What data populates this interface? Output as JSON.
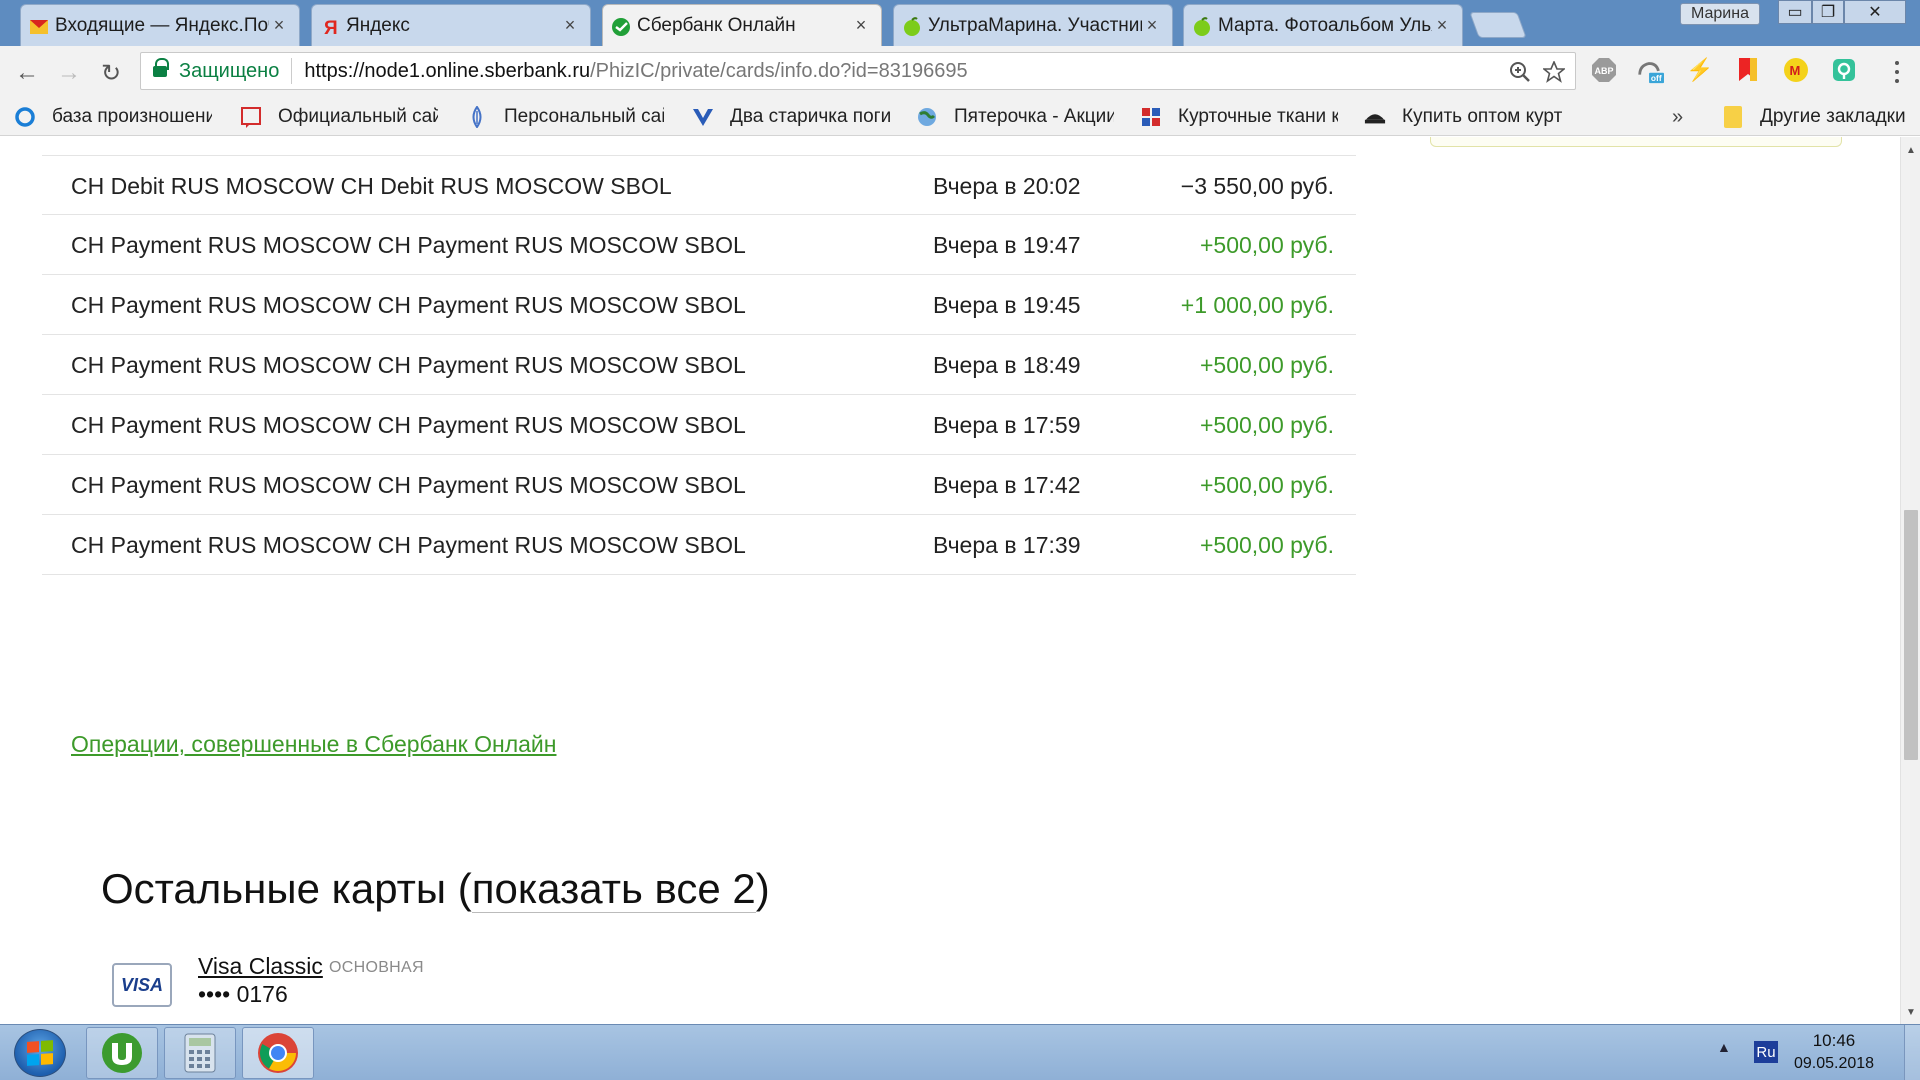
{
  "colors": {
    "positive": "#3d9a2a",
    "negative": "#222222",
    "link_green": "#3d9a2a",
    "secure_green": "#0b8043"
  },
  "browser": {
    "tabs": [
      {
        "title": "Входящие — Яндекс.Почта",
        "icon": "mail-icon",
        "close": "×"
      },
      {
        "title": "Яндекс",
        "icon": "yandex-icon",
        "close": "×"
      },
      {
        "title": "Сбербанк Онлайн",
        "icon": "sberbank-icon",
        "close": "×",
        "active": true
      },
      {
        "title": "УльтраМарина. Участники",
        "icon": "apple-icon",
        "close": "×"
      },
      {
        "title": "Марта. Фотоальбом Ульяна",
        "icon": "apple-icon",
        "close": "×"
      }
    ],
    "profile_name": "Марина",
    "window_controls": {
      "minimize": "▭",
      "restore": "❐",
      "close": "✕"
    },
    "nav": {
      "back": "←",
      "forward": "→",
      "reload": "↻"
    },
    "address": {
      "secure_label": "Защищено",
      "url_host": "https://node1.online.sberbank.ru",
      "url_path": "/PhizIC/private/cards/info.do?id=83196695"
    },
    "extensions": [
      {
        "name": "adblock-icon",
        "label": "ABP"
      },
      {
        "name": "vpn-off-icon",
        "label": "off"
      },
      {
        "name": "lightning-icon",
        "label": "⚡"
      },
      {
        "name": "bookmark-flag-icon",
        "label": ""
      },
      {
        "name": "metro-icon",
        "label": "M"
      },
      {
        "name": "screenshot-icon",
        "label": ""
      }
    ],
    "bookmarks": [
      {
        "label": "база произношений",
        "icon": "circle-icon"
      },
      {
        "label": "Официальный сайт",
        "icon": "frame-icon"
      },
      {
        "label": "Персональный сайт",
        "icon": "drop-icon"
      },
      {
        "label": "Два старичка погибли",
        "icon": "news-icon"
      },
      {
        "label": "Пятерочка - Акции",
        "icon": "globe-icon"
      },
      {
        "label": "Курточные ткани купить",
        "icon": "fabric-icon"
      },
      {
        "label": "Купить оптом куртки",
        "icon": "hat-icon"
      }
    ],
    "bookmarks_more": "»",
    "other_bookmarks": "Другие закладки"
  },
  "transactions": [
    {
      "description": "CH Debit RUS MOSCOW CH Debit RUS MOSCOW SBOL",
      "date": "Вчера в 20:02",
      "amount": "−3 550,00 руб.",
      "sign": "negative"
    },
    {
      "description": "CH Payment RUS MOSCOW CH Payment RUS MOSCOW SBOL",
      "date": "Вчера в 19:47",
      "amount": "+500,00 руб.",
      "sign": "positive"
    },
    {
      "description": "CH Payment RUS MOSCOW CH Payment RUS MOSCOW SBOL",
      "date": "Вчера в 19:45",
      "amount": "+1 000,00 руб.",
      "sign": "positive"
    },
    {
      "description": "CH Payment RUS MOSCOW CH Payment RUS MOSCOW SBOL",
      "date": "Вчера в 18:49",
      "amount": "+500,00 руб.",
      "sign": "positive"
    },
    {
      "description": "CH Payment RUS MOSCOW CH Payment RUS MOSCOW SBOL",
      "date": "Вчера в 17:59",
      "amount": "+500,00 руб.",
      "sign": "positive"
    },
    {
      "description": "CH Payment RUS MOSCOW CH Payment RUS MOSCOW SBOL",
      "date": "Вчера в 17:42",
      "amount": "+500,00 руб.",
      "sign": "positive"
    },
    {
      "description": "CH Payment RUS MOSCOW CH Payment RUS MOSCOW SBOL",
      "date": "Вчера в 17:39",
      "amount": "+500,00 руб.",
      "sign": "positive"
    }
  ],
  "ops_link": "Операции, совершенные в Сбербанк Онлайн",
  "other_cards": {
    "title_prefix": "Остальные карты (",
    "show_all": "показать все 2",
    "title_suffix": ")"
  },
  "card": {
    "logo_text": "VISA",
    "name": "Visa Classic ",
    "tag": "ОСНОВНАЯ",
    "number": "•••• 0176"
  },
  "scrollbar": {
    "up": "▲",
    "down": "▼"
  },
  "taskbar": {
    "apps": [
      {
        "name": "utorrent-taskbar-icon"
      },
      {
        "name": "calculator-taskbar-icon"
      },
      {
        "name": "chrome-taskbar-icon"
      }
    ],
    "tray_arrow": "▲",
    "language": "Ru",
    "time": "10:46",
    "date": "09.05.2018"
  }
}
